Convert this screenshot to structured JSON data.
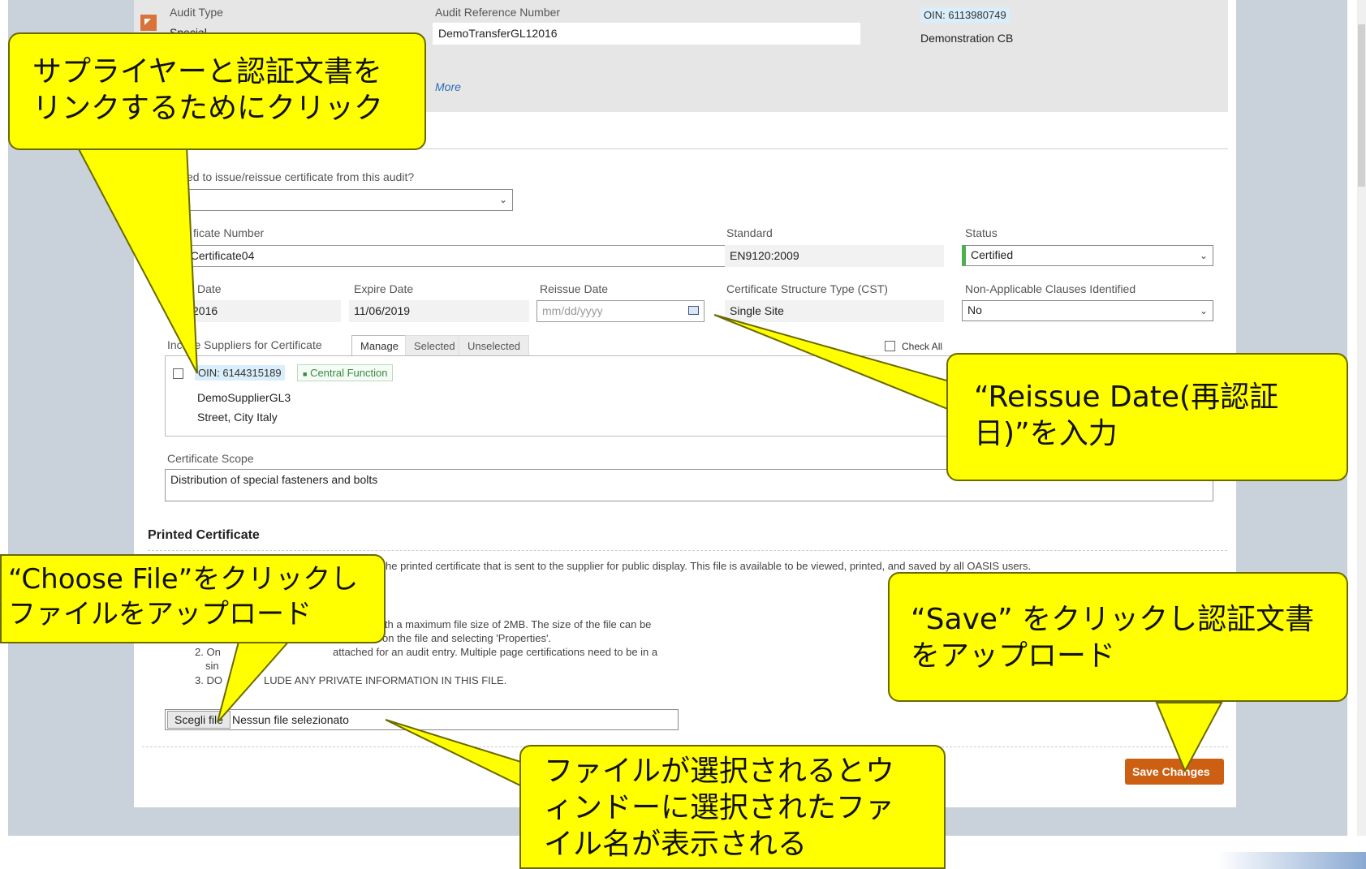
{
  "audit": {
    "type_label": "Audit Type",
    "type_value": "Special",
    "ref_label": "Audit Reference Number",
    "ref_value": "DemoTransferGL12016",
    "oin": "OIN: 6113980749",
    "cb_name": "Demonstration CB",
    "more_link": "More"
  },
  "form": {
    "question": "ed to issue/reissue certificate from this audit?",
    "certificate_number_label": "ficate Number",
    "certificate_number_value": "oCertificate04",
    "standard_label": "Standard",
    "standard_value": "EN9120:2009",
    "status_label": "Status",
    "status_value": "Certified",
    "issue_date_label": "Date",
    "issue_date_value": "2016",
    "expire_date_label": "Expire Date",
    "expire_date_value": "11/06/2019",
    "reissue_date_label": "Reissue Date",
    "reissue_date_placeholder": "mm/dd/yyyy",
    "cst_label": "Certificate Structure Type (CST)",
    "cst_value": "Single Site",
    "nac_label": "Non-Applicable Clauses Identified",
    "nac_value": "No"
  },
  "suppliers": {
    "label": "Incl   e Suppliers for Certificate",
    "tabs": [
      "Manage",
      "Selected",
      "Unselected"
    ],
    "check_all": "Check All",
    "item": {
      "oin": "OIN: 6144315189",
      "badge": "Central Function",
      "name": "DemoSupplierGL3",
      "address": "Street, City Italy"
    }
  },
  "scope": {
    "label": "Certificate Scope",
    "value": "Distribution of special fasteners and bolts"
  },
  "printed": {
    "heading": "Printed Certificate",
    "desc": "he printed certificate that is sent to the supplier for public display. This file is available to be viewed, printed, and saved by all OASIS users.",
    "note1a": "ith a maximum file size of 2MB. The size of the file can be",
    "note1b": "on the file and selecting 'Properties'.",
    "note2a": "2. On",
    "note2b": "attached for an audit entry. Multiple page certifications need to be in a",
    "note2c": "sin",
    "note3a": "3. DO",
    "note3b": "LUDE ANY PRIVATE INFORMATION IN THIS FILE.",
    "choose_button": "Scegli file",
    "no_file": "Nessun file selezionato",
    "save_button": "Save Changes"
  },
  "callouts": {
    "link_supplier": "サプライヤーと認証文書をリンクするためにクリック",
    "reissue_date": "“Reissue Date(再認証日)”を入力",
    "choose_file": "“Choose File”をクリックしファイルをアップロード",
    "save": "“Save” をクリックし認証文書をアップロード",
    "file_selected": "ファイルが選択されるとウィンドーに選択されたファイル名が表示される"
  },
  "colors": {
    "callout_fill": "#ffff00",
    "save_button": "#cc5f12",
    "status_accent": "#4caf50"
  }
}
